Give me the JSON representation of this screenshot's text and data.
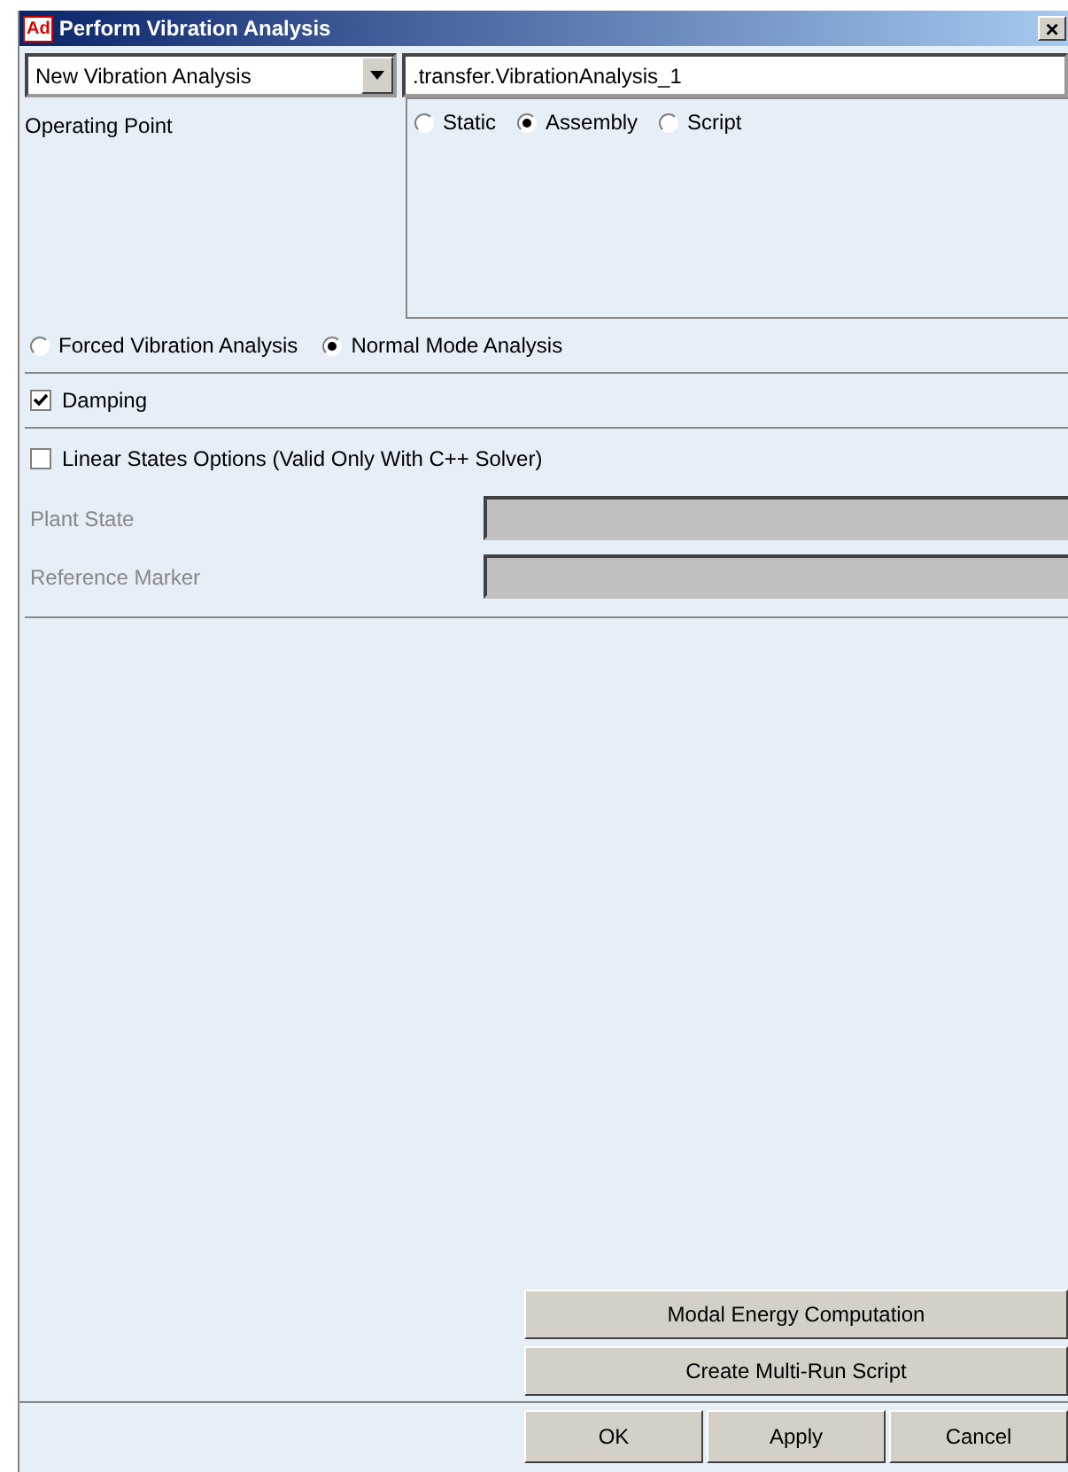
{
  "window": {
    "title": "Perform Vibration Analysis",
    "close": "×",
    "app_badge": "Ad"
  },
  "analysis_dropdown": {
    "value": "New Vibration Analysis"
  },
  "analysis_name": {
    "value": ".transfer.VibrationAnalysis_1"
  },
  "operating_point": {
    "label": "Operating Point",
    "options": [
      {
        "label": "Static",
        "selected": false
      },
      {
        "label": "Assembly",
        "selected": true
      },
      {
        "label": "Script",
        "selected": false
      }
    ]
  },
  "analysis_type": [
    {
      "label": "Forced Vibration Analysis",
      "selected": false
    },
    {
      "label": "Normal Mode Analysis",
      "selected": true
    }
  ],
  "damping": {
    "label": "Damping",
    "checked": true
  },
  "linear_states": {
    "label": "Linear States Options (Valid Only With C++ Solver)",
    "checked": false
  },
  "linear_fields": [
    {
      "label": "Plant State",
      "disabled": true
    },
    {
      "label": "Reference Marker",
      "disabled": true
    }
  ],
  "tool_buttons": [
    "Modal Energy Computation",
    "Create Multi-Run Script"
  ],
  "buttons": [
    "OK",
    "Apply",
    "Cancel"
  ]
}
